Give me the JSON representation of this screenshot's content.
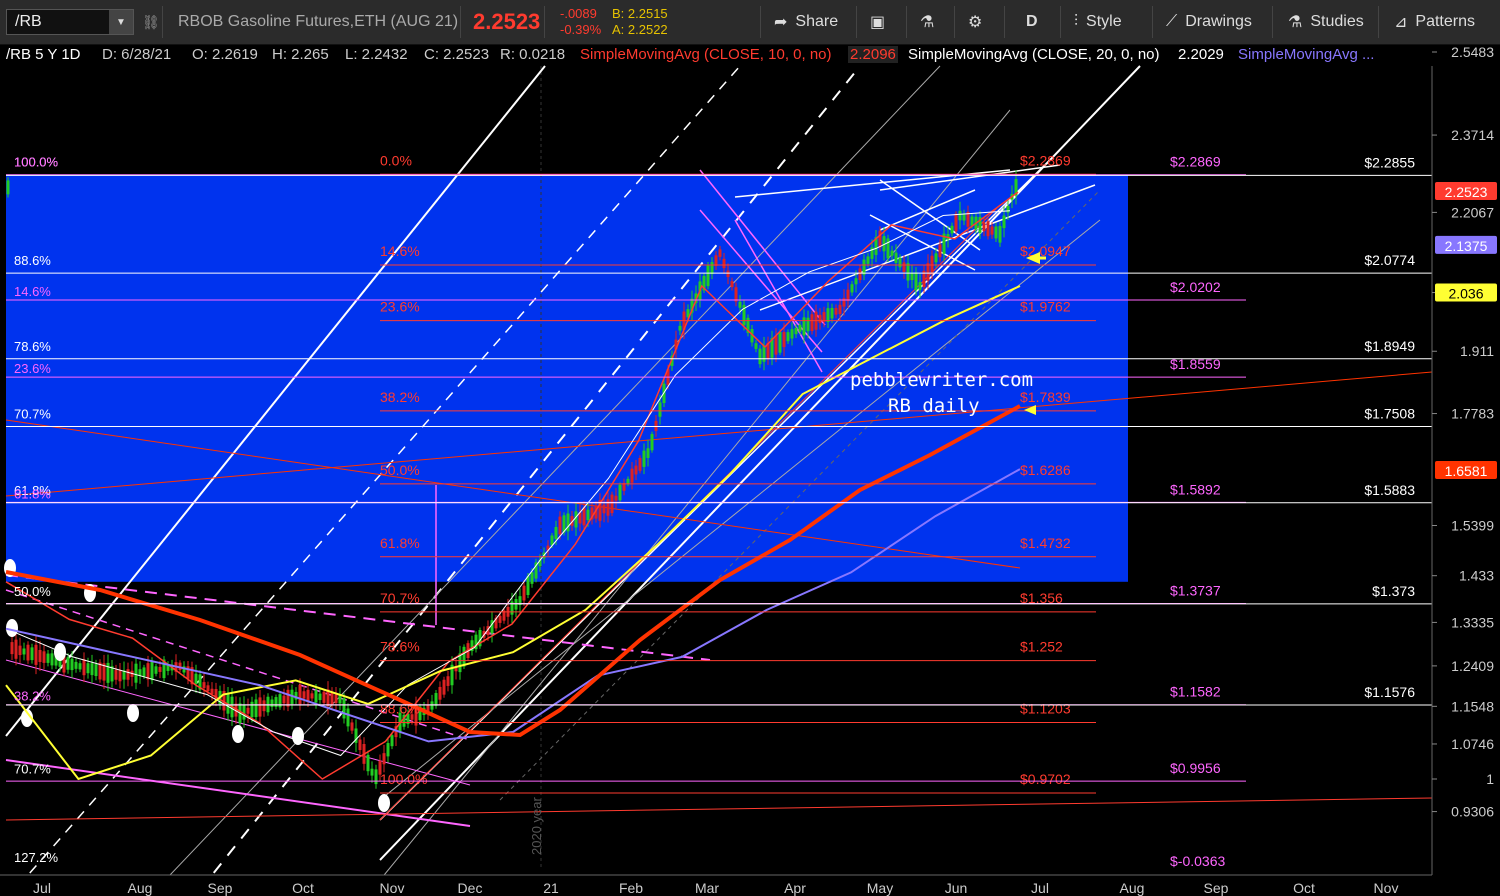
{
  "toolbar": {
    "symbol": "/RB",
    "description": "RBOB Gasoline Futures,ETH (AUG 21)",
    "last": "2.2523",
    "change": "-.0089",
    "change_pct": "-0.39%",
    "bid": "B: 2.2515",
    "ask": "A: 2.2522",
    "share_label": "Share",
    "period_label": "D",
    "style_label": "Style",
    "drawings_label": "Drawings",
    "studies_label": "Studies",
    "patterns_label": "Patterns"
  },
  "infobar": {
    "symbol": "/RB 5 Y 1D",
    "date": "D: 6/28/21",
    "open": "O: 2.2619",
    "high": "H: 2.265",
    "low": "L: 2.2432",
    "close": "C: 2.2523",
    "range": "R: 0.0218",
    "sma10": "SimpleMovingAvg (CLOSE, 10, 0, no)",
    "sma10_value": "2.2096",
    "sma20": "SimpleMovingAvg (CLOSE, 20, 0, no)",
    "sma20_value": "2.2029",
    "sma_more": "SimpleMovingAvg ..."
  },
  "colors": {
    "fill_blue": "#0033ee",
    "fib_red": "#ff3b2f",
    "fib_pink": "#ff66ff",
    "sma_yellow": "#ffff33",
    "sma_orange": "#ff3300",
    "sma_purple": "#8877ff",
    "candle_up": "#22cc22",
    "candle_down": "#dd2222",
    "background": "#000000"
  },
  "chart_data": {
    "type": "line",
    "title": "",
    "ylim": [
      0.9,
      2.6
    ],
    "watermark": [
      "pebblewriter.com",
      "RB daily"
    ],
    "year_marker": "2020 year",
    "x_ticks": [
      "Jul",
      "Aug",
      "Sep",
      "Oct",
      "Nov",
      "Dec",
      "21",
      "Feb",
      "Mar",
      "Apr",
      "May",
      "Jun",
      "Jul",
      "Aug",
      "Sep",
      "Oct",
      "Nov"
    ],
    "y_ticks": [
      "2.5483",
      "2.3714",
      "2.2067",
      "2.036",
      "1.911",
      "1.7783",
      "1.5399",
      "1.433",
      "1.3335",
      "1.2409",
      "1.1548",
      "1.0746",
      "1",
      "0.9306"
    ],
    "price_badges": [
      {
        "label": "2.2523",
        "value": 2.2523,
        "color": "#ff3b2f"
      },
      {
        "label": "2.1375",
        "value": 2.1375,
        "color": "#8877ff"
      },
      {
        "label": "2.036",
        "value": 2.036,
        "color": "#ffff33"
      },
      {
        "label": "1.6581",
        "value": 1.6581,
        "color": "#ff3300"
      }
    ],
    "fib_red": [
      {
        "pct": "0.0%",
        "price": "$2.2869",
        "value": 2.2869
      },
      {
        "pct": "14.6%",
        "price": "$2.0947",
        "value": 2.0947
      },
      {
        "pct": "23.6%",
        "price": "$1.9762",
        "value": 1.9762
      },
      {
        "pct": "38.2%",
        "price": "$1.7839",
        "value": 1.7839
      },
      {
        "pct": "50.0%",
        "price": "$1.6286",
        "value": 1.6286
      },
      {
        "pct": "61.8%",
        "price": "$1.4732",
        "value": 1.4732
      },
      {
        "pct": "70.7%",
        "price": "$1.356",
        "value": 1.356
      },
      {
        "pct": "78.6%",
        "price": "$1.252",
        "value": 1.252
      },
      {
        "pct": "88.6%",
        "price": "$1.1203",
        "value": 1.1203
      },
      {
        "pct": "100.0%",
        "price": "$0.9702",
        "value": 0.9702
      }
    ],
    "fib_pink": [
      {
        "price": "$2.2869",
        "value": 2.2869
      },
      {
        "price": "$2.0202",
        "value": 2.0202
      },
      {
        "price": "$1.8559",
        "value": 1.8559
      },
      {
        "price": "$1.5892",
        "value": 1.5892
      },
      {
        "price": "$1.3737",
        "value": 1.3737
      },
      {
        "price": "$1.1582",
        "value": 1.1582
      },
      {
        "price": "$0.9956",
        "value": 0.9956
      },
      {
        "price": "$-0.0363",
        "value": 0.92
      }
    ],
    "left_pink_pct": [
      {
        "pct": "100.0%",
        "value": 2.2869
      },
      {
        "pct": "14.6%",
        "value": 2.0202
      },
      {
        "pct": "23.6%",
        "value": 1.8559
      },
      {
        "pct": "61.8%",
        "value": 1.5892
      },
      {
        "pct": "38.2%",
        "value": 1.1582
      }
    ],
    "left_white_pct": [
      {
        "pct": "100.0%",
        "value": 2.2869
      },
      {
        "pct": "88.6%",
        "value": 2.0774
      },
      {
        "pct": "78.6%",
        "value": 1.8949
      },
      {
        "pct": "70.7%",
        "value": 1.7508
      },
      {
        "pct": "61.8%",
        "value": 1.5883
      },
      {
        "pct": "50.0%",
        "value": 1.373
      },
      {
        "pct": "70.7%",
        "value": 0.995
      },
      {
        "pct": "127.2%",
        "value": 0.91
      }
    ],
    "white_levels": [
      {
        "price": "$2.2855",
        "value": 2.2855
      },
      {
        "price": "$2.0774",
        "value": 2.0774
      },
      {
        "price": "$1.8949",
        "value": 1.8949
      },
      {
        "price": "$1.7508",
        "value": 1.7508
      },
      {
        "price": "$1.5883",
        "value": 1.5883
      },
      {
        "price": "$1.373",
        "value": 1.373
      },
      {
        "price": "$1.1576",
        "value": 1.1576
      }
    ],
    "series": [
      {
        "values": [
          1.42,
          1.34,
          1.3,
          1.2,
          1.12,
          1.0,
          1.08,
          1.25,
          1.33,
          1.5,
          1.72,
          2.05,
          1.92,
          2.06,
          2.18,
          2.15,
          2.25
        ]
      },
      {
        "values": [
          1.32,
          1.26,
          1.22,
          1.18,
          1.1,
          1.05,
          1.2,
          1.28,
          1.47,
          1.64,
          1.86,
          2.0,
          2.08,
          2.13,
          2.2,
          2.21
        ]
      },
      {
        "values": [
          1.2,
          1.0,
          1.05,
          1.18,
          1.21,
          1.16,
          1.23,
          1.27,
          1.36,
          1.5,
          1.65,
          1.82,
          1.9,
          1.98,
          2.05
        ]
      },
      {
        "values": [
          1.32,
          1.28,
          1.24,
          1.2,
          1.14,
          1.08,
          1.1,
          1.22,
          1.26,
          1.36,
          1.44,
          1.56,
          1.66
        ]
      }
    ]
  }
}
